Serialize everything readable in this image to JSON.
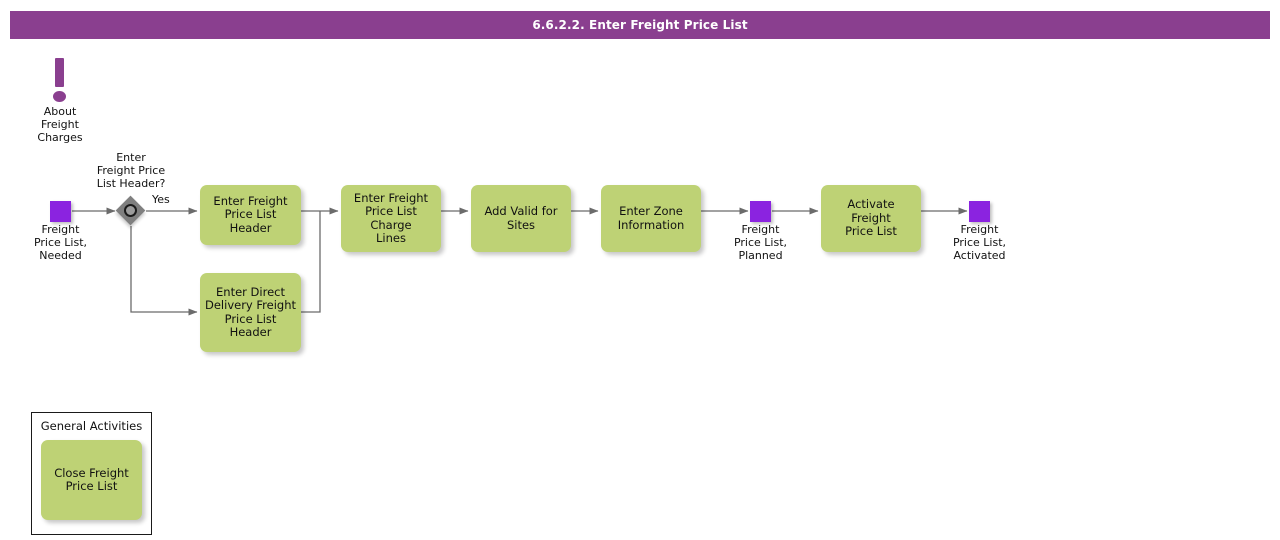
{
  "header": {
    "title": "6.6.2.2. Enter Freight Price List"
  },
  "colors": {
    "header_purple": "#8a3f8f",
    "task_green": "#bed275",
    "event_purple": "#8b23e0",
    "gateway_gray": "#7f7f7f",
    "connector_gray": "#666666"
  },
  "annotation": {
    "icon": "exclamation-icon",
    "label": "About\nFreight\nCharges"
  },
  "events": [
    {
      "name": "start-event",
      "label": "Freight\nPrice List,\nNeeded"
    },
    {
      "name": "milestone-event",
      "label": "Freight\nPrice List,\nPlanned"
    },
    {
      "name": "end-event",
      "label": "Freight\nPrice List,\nActivated"
    }
  ],
  "gateway": {
    "name": "gateway-enter-freight-price-list-header",
    "label": "Enter\nFreight Price\nList Header?",
    "branch_label": "Yes"
  },
  "tasks": [
    {
      "name": "task-enter-freight-price-list-header",
      "label": "Enter Freight\nPrice List Header"
    },
    {
      "name": "task-enter-direct-delivery-freight-price-list-header",
      "label": "Enter Direct\nDelivery Freight\nPrice List Header"
    },
    {
      "name": "task-enter-freight-price-list-charge-lines",
      "label": "Enter Freight\nPrice List Charge\nLines"
    },
    {
      "name": "task-add-valid-for-sites",
      "label": "Add Valid for\nSites"
    },
    {
      "name": "task-enter-zone-information",
      "label": "Enter Zone\nInformation"
    },
    {
      "name": "task-activate-freight-price-list",
      "label": "Activate Freight\nPrice List"
    }
  ],
  "general_activities": {
    "title": "General Activities",
    "tasks": [
      {
        "name": "task-close-freight-price-list",
        "label": "Close Freight\nPrice List"
      }
    ]
  }
}
